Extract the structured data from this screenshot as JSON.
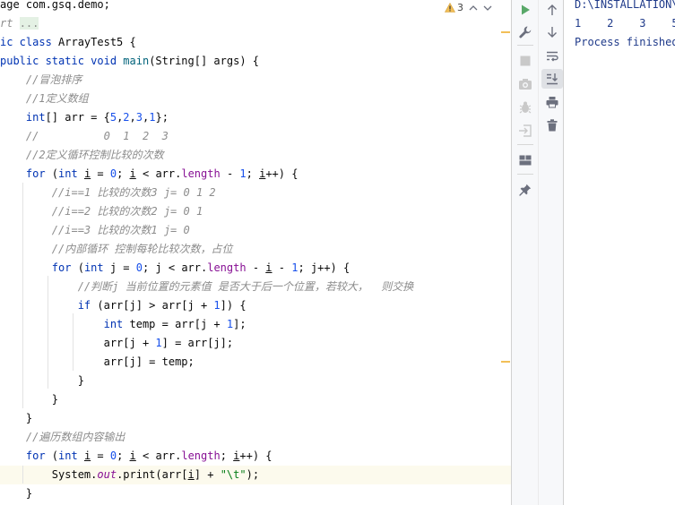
{
  "editor": {
    "inspection": {
      "warning_count": "3"
    },
    "lines": [
      [
        {
          "t": "p",
          "v": "age com.gsq.demo;"
        }
      ],
      [
        {
          "t": "c",
          "v": "rt "
        },
        {
          "t": "fold",
          "v": "..."
        }
      ],
      [
        {
          "t": "k",
          "v": "ic class "
        },
        {
          "t": "p",
          "v": "ArrayTest5 {"
        }
      ],
      [
        {
          "t": "k",
          "v": "public static void "
        },
        {
          "t": "m",
          "v": "main"
        },
        {
          "t": "p",
          "v": "(String[] args) {"
        }
      ],
      [
        {
          "t": "c",
          "v": "    //冒泡排序"
        }
      ],
      [
        {
          "t": "c",
          "v": "    //1定义数组"
        }
      ],
      [
        {
          "t": "k",
          "v": "    int"
        },
        {
          "t": "p",
          "v": "[] arr = {"
        },
        {
          "t": "n",
          "v": "5"
        },
        {
          "t": "p",
          "v": ","
        },
        {
          "t": "n",
          "v": "2"
        },
        {
          "t": "p",
          "v": ","
        },
        {
          "t": "n",
          "v": "3"
        },
        {
          "t": "p",
          "v": ","
        },
        {
          "t": "n",
          "v": "1"
        },
        {
          "t": "p",
          "v": "};"
        }
      ],
      [
        {
          "t": "c",
          "v": "    //          0  1  2  3"
        }
      ],
      [
        {
          "t": "c",
          "v": "    //2定义循环控制比较的次数"
        }
      ],
      [
        {
          "t": "k",
          "v": "    for "
        },
        {
          "t": "p",
          "v": "("
        },
        {
          "t": "k",
          "v": "int "
        },
        {
          "t": "u",
          "v": "i"
        },
        {
          "t": "p",
          "v": " = "
        },
        {
          "t": "n",
          "v": "0"
        },
        {
          "t": "p",
          "v": "; "
        },
        {
          "t": "u",
          "v": "i"
        },
        {
          "t": "p",
          "v": " < arr."
        },
        {
          "t": "f",
          "v": "length"
        },
        {
          "t": "p",
          "v": " - "
        },
        {
          "t": "n",
          "v": "1"
        },
        {
          "t": "p",
          "v": "; "
        },
        {
          "t": "u",
          "v": "i"
        },
        {
          "t": "p",
          "v": "++) {"
        }
      ],
      [
        {
          "t": "c",
          "v": "        //i==1 比较的次数3 j= 0 1 2"
        }
      ],
      [
        {
          "t": "c",
          "v": "        //i==2 比较的次数2 j= 0 1"
        }
      ],
      [
        {
          "t": "c",
          "v": "        //i==3 比较的次数1 j= 0"
        }
      ],
      [
        {
          "t": "c",
          "v": "        //内部循环 控制每轮比较次数，占位"
        }
      ],
      [
        {
          "t": "k",
          "v": "        for "
        },
        {
          "t": "p",
          "v": "("
        },
        {
          "t": "k",
          "v": "int "
        },
        {
          "t": "p",
          "v": "j = "
        },
        {
          "t": "n",
          "v": "0"
        },
        {
          "t": "p",
          "v": "; j < arr."
        },
        {
          "t": "f",
          "v": "length"
        },
        {
          "t": "p",
          "v": " - "
        },
        {
          "t": "u",
          "v": "i"
        },
        {
          "t": "p",
          "v": " - "
        },
        {
          "t": "n",
          "v": "1"
        },
        {
          "t": "p",
          "v": "; j++) {"
        }
      ],
      [
        {
          "t": "c",
          "v": "            //判断j 当前位置的元素值 是否大于后一个位置，若较大，  则交换"
        }
      ],
      [
        {
          "t": "k",
          "v": "            if "
        },
        {
          "t": "p",
          "v": "(arr[j] > arr[j + "
        },
        {
          "t": "n",
          "v": "1"
        },
        {
          "t": "p",
          "v": "]) {"
        }
      ],
      [
        {
          "t": "k",
          "v": "                int "
        },
        {
          "t": "p",
          "v": "temp = arr[j + "
        },
        {
          "t": "n",
          "v": "1"
        },
        {
          "t": "p",
          "v": "];"
        }
      ],
      [
        {
          "t": "p",
          "v": "                arr[j + "
        },
        {
          "t": "n",
          "v": "1"
        },
        {
          "t": "p",
          "v": "] = arr[j];"
        }
      ],
      [
        {
          "t": "p",
          "v": "                arr[j] = temp;"
        }
      ],
      [
        {
          "t": "p",
          "v": "            }"
        }
      ],
      [
        {
          "t": "p",
          "v": "        }"
        }
      ],
      [
        {
          "t": "p",
          "v": "    }"
        }
      ],
      [
        {
          "t": "c",
          "v": "    //遍历数组内容输出"
        }
      ],
      [
        {
          "t": "k",
          "v": "    for "
        },
        {
          "t": "p",
          "v": "("
        },
        {
          "t": "k",
          "v": "int "
        },
        {
          "t": "u",
          "v": "i"
        },
        {
          "t": "p",
          "v": " = "
        },
        {
          "t": "n",
          "v": "0"
        },
        {
          "t": "p",
          "v": "; "
        },
        {
          "t": "u",
          "v": "i"
        },
        {
          "t": "p",
          "v": " < arr."
        },
        {
          "t": "f",
          "v": "length"
        },
        {
          "t": "p",
          "v": "; "
        },
        {
          "t": "u",
          "v": "i"
        },
        {
          "t": "p",
          "v": "++) {"
        }
      ],
      [
        {
          "t": "p",
          "v": "        System."
        },
        {
          "t": "st",
          "v": "out"
        },
        {
          "t": "p",
          "v": ".print(arr["
        },
        {
          "t": "u",
          "v": "i"
        },
        {
          "t": "p",
          "v": "] + "
        },
        {
          "t": "s",
          "v": "\"\\t\""
        },
        {
          "t": "p",
          "v": ");"
        }
      ],
      [
        {
          "t": "p",
          "v": "    }"
        }
      ]
    ]
  },
  "toolbar_a": {
    "buttons": [
      "rerun-icon",
      "wrench-icon",
      "stop-icon",
      "camera-icon",
      "debug-icon",
      "exit-icon",
      "layout-icon",
      "pin-icon"
    ]
  },
  "toolbar_b": {
    "buttons": [
      "up-arrow-icon",
      "down-arrow-icon",
      "soft-wrap-icon",
      "scroll-to-end-icon",
      "print-icon",
      "trash-icon"
    ]
  },
  "console": {
    "lines": [
      "D:\\INSTALLATION\\",
      "1    2    3    5",
      "Process finished"
    ]
  },
  "colors": {
    "keyword": "#0033b3",
    "number": "#1750eb",
    "string": "#067d17",
    "comment": "#8c8c8c",
    "field": "#871094",
    "run_green": "#59a869",
    "warning": "#f2bf57",
    "console_text": "#1f3a8a"
  }
}
